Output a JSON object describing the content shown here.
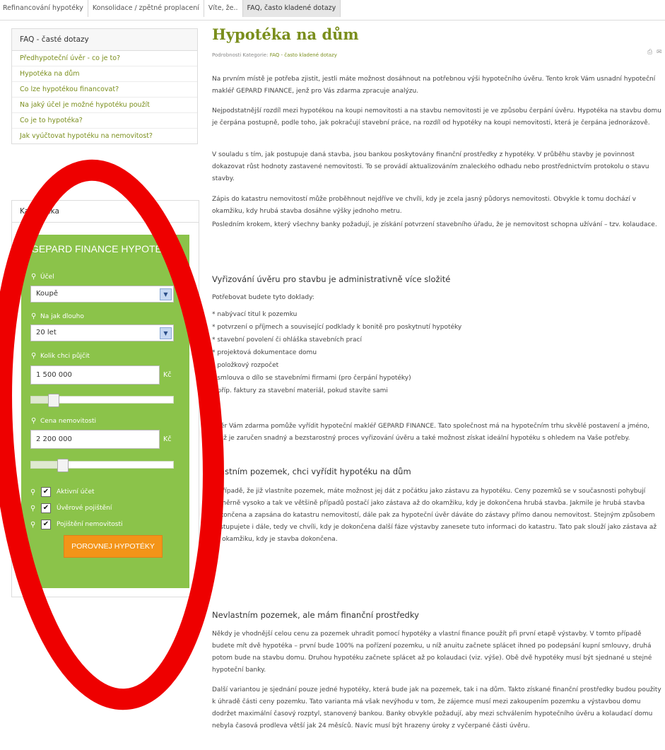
{
  "nav": {
    "tabs": [
      {
        "label": "Refinancování hypotéky"
      },
      {
        "label": "Konsolidace / zpětné proplacení"
      },
      {
        "label": "Víte, že.."
      },
      {
        "label": "FAQ, často kladené dotazy"
      }
    ]
  },
  "faq_box": {
    "title": "FAQ - časté dotazy",
    "items": [
      "Předhypoteční úvěr - co je to?",
      "Hypotéka na dům",
      "Co lze hypotékou financovat?",
      "Na jaký účel je možné hypotéku použít",
      "Co je to hypotéka?",
      "Jak vyúčtovat hypotéku na nemovitost?"
    ]
  },
  "calculator": {
    "box_title": "Kalkulačka",
    "heading": "GEPARD FINANCE HYPOTEČNÍ",
    "purpose_label": "Účel",
    "purpose_value": "Koupě",
    "term_label": "Na jak dlouho",
    "term_value": "20 let",
    "loan_label": "Kolik chci půjčit",
    "loan_value": "1 500 000",
    "loan_unit": "Kč",
    "loan_slider_fraction": 0.13,
    "price_label": "Cena nemovitosti",
    "price_value": "2 200 000",
    "price_unit": "Kč",
    "price_slider_fraction": 0.2,
    "checkboxes": [
      {
        "label": "Aktivní účet",
        "checked": true
      },
      {
        "label": "Úvěrové pojištění",
        "checked": true
      },
      {
        "label": "Pojištění nemovitosti",
        "checked": true
      }
    ],
    "button_label": "POROVNEJ HYPOTÉKY"
  },
  "article": {
    "title": "Hypotéka na dům",
    "meta_prefix": "Podrobnosti  Kategorie:",
    "meta_category": "FAQ - často kladené dotazy",
    "p1": "Na prvním místě je potřeba zjistit, jestli máte možnost dosáhnout na potřebnou výši hypotečního úvěru. Tento krok Vám usnadní hypoteční makléř GEPARD FINANCE, jenž pro Vás zdarma zpracuje analýzu.",
    "p2": "Nejpodstatnější rozdíl mezi hypotékou na koupi nemovitosti a na stavbu nemovitosti je ve způsobu čerpání úvěru. Hypotéka na stavbu domu je čerpána postupně, podle toho, jak pokračují stavební práce, na rozdíl od hypotéky na koupi nemovitosti, která je čerpána jednorázově.",
    "p3": "V souladu s tím, jak postupuje daná stavba, jsou bankou poskytovány finanční prostředky z hypotéky. V průběhu stavby je povinnost dokazovat růst hodnoty zastavené nemovitosti. To se provádí aktualizováním znaleckého odhadu nebo prostřednictvím protokolu o stavu stavby.",
    "p4": "Zápis do katastru nemovitostí může proběhnout nejdříve ve chvíli, kdy je zcela jasný půdorys nemovitosti. Obvykle k tomu dochází v okamžiku, kdy hrubá stavba dosáhne výšky jednoho metru.",
    "p5": "Posledním krokem, který všechny banky požadují, je získání potvrzení stavebního úřadu, že je nemovitost schopna užívání – tzv. kolaudace.",
    "h1": "Vyřizování úvěru pro stavbu je administrativně více složité",
    "docs_intro": "Potřebovat budete tyto doklady:",
    "docs": [
      "* nabývací titul k pozemku",
      "* potvrzení o příjmech a související podklady k bonitě pro poskytnutí hypotéky",
      "* stavební povolení či ohláška stavebních prací",
      "* projektová dokumentace domu",
      "* položkový rozpočet",
      "* smlouva o dílo se stavebními firmami (pro čerpání hypotéky)",
      "* příp. faktury za stavební materiál, pokud stavíte sami"
    ],
    "p6": "Úvěr Vám zdarma pomůže vyřídit hypoteční makléř GEPARD FINANCE. Tato společnost má na hypotečním trhu skvělé postavení a jméno, čímž je zaručen snadný a bezstarostný proces vyřizování úvěru a také možnost získat ideální hypotéku s ohledem na Vaše potřeby.",
    "h2": "Vlastním pozemek, chci vyřídit hypotéku na dům",
    "p7": "V případě, že již vlastníte pozemek, máte možnost jej dát z počátku jako zástavu za hypotéku. Ceny pozemků se v současnosti pohybují poměrně vysoko a tak ve většině případů postačí jako zástava až do okamžiku, kdy je dokončena hrubá stavba. Jakmile je hrubá stavba dokončena a zapsána do katastru nemovitostí, dále pak za hypoteční úvěr dáváte do zástavy přímo danou nemovitost. Stejným způsobem postupujete i dále, tedy ve chvíli, kdy je dokončena další fáze výstavby zanesete tuto informaci do katastru. Tato pak slouží jako zástava až do okamžiku, kdy je stavba dokončena.",
    "h3": "Nevlastním pozemek, ale mám finanční prostředky",
    "p8": "Někdy je vhodnější celou cenu za pozemek uhradit pomocí hypotéky a vlastní finance použít při první etapě výstavby. V tomto případě budete mít dvě hypotéka – první bude 100% na pořízení pozemku, u níž anuitu začnete splácet ihned po podepsání kupní smlouvy, druhá potom bude na stavbu domu. Druhou hypotéku začnete splácet až po kolaudaci (viz. výše). Obě dvě hypotéky musí být sjednané u stejné hypoteční banky.",
    "p9": "Další variantou je sjednání pouze jedné hypotéky, která bude jak na pozemek, tak i na dům. Takto získané finanční prostředky budou použity k úhradě části ceny pozemku. Tato varianta má však nevýhodu v tom, že zájemce musí mezi zakoupením pozemku a výstavbou domu dodržet maximální časový rozptyl, stanovený bankou. Banky obvykle požadují, aby mezi schválením hypotečního úvěru a kolaudací domu nebyla časová prodleva větší jak 24 měsíců. Navíc musí být hrazeny úroky z vyčerpané části úvěru."
  },
  "colors": {
    "accent": "#7a8e1c",
    "calc_green": "#8bc34a",
    "button_orange": "#f39418",
    "annotation_red": "#ee0000"
  },
  "icons": {
    "bulb": "bulb-icon",
    "print": "print-icon",
    "email": "email-icon"
  }
}
